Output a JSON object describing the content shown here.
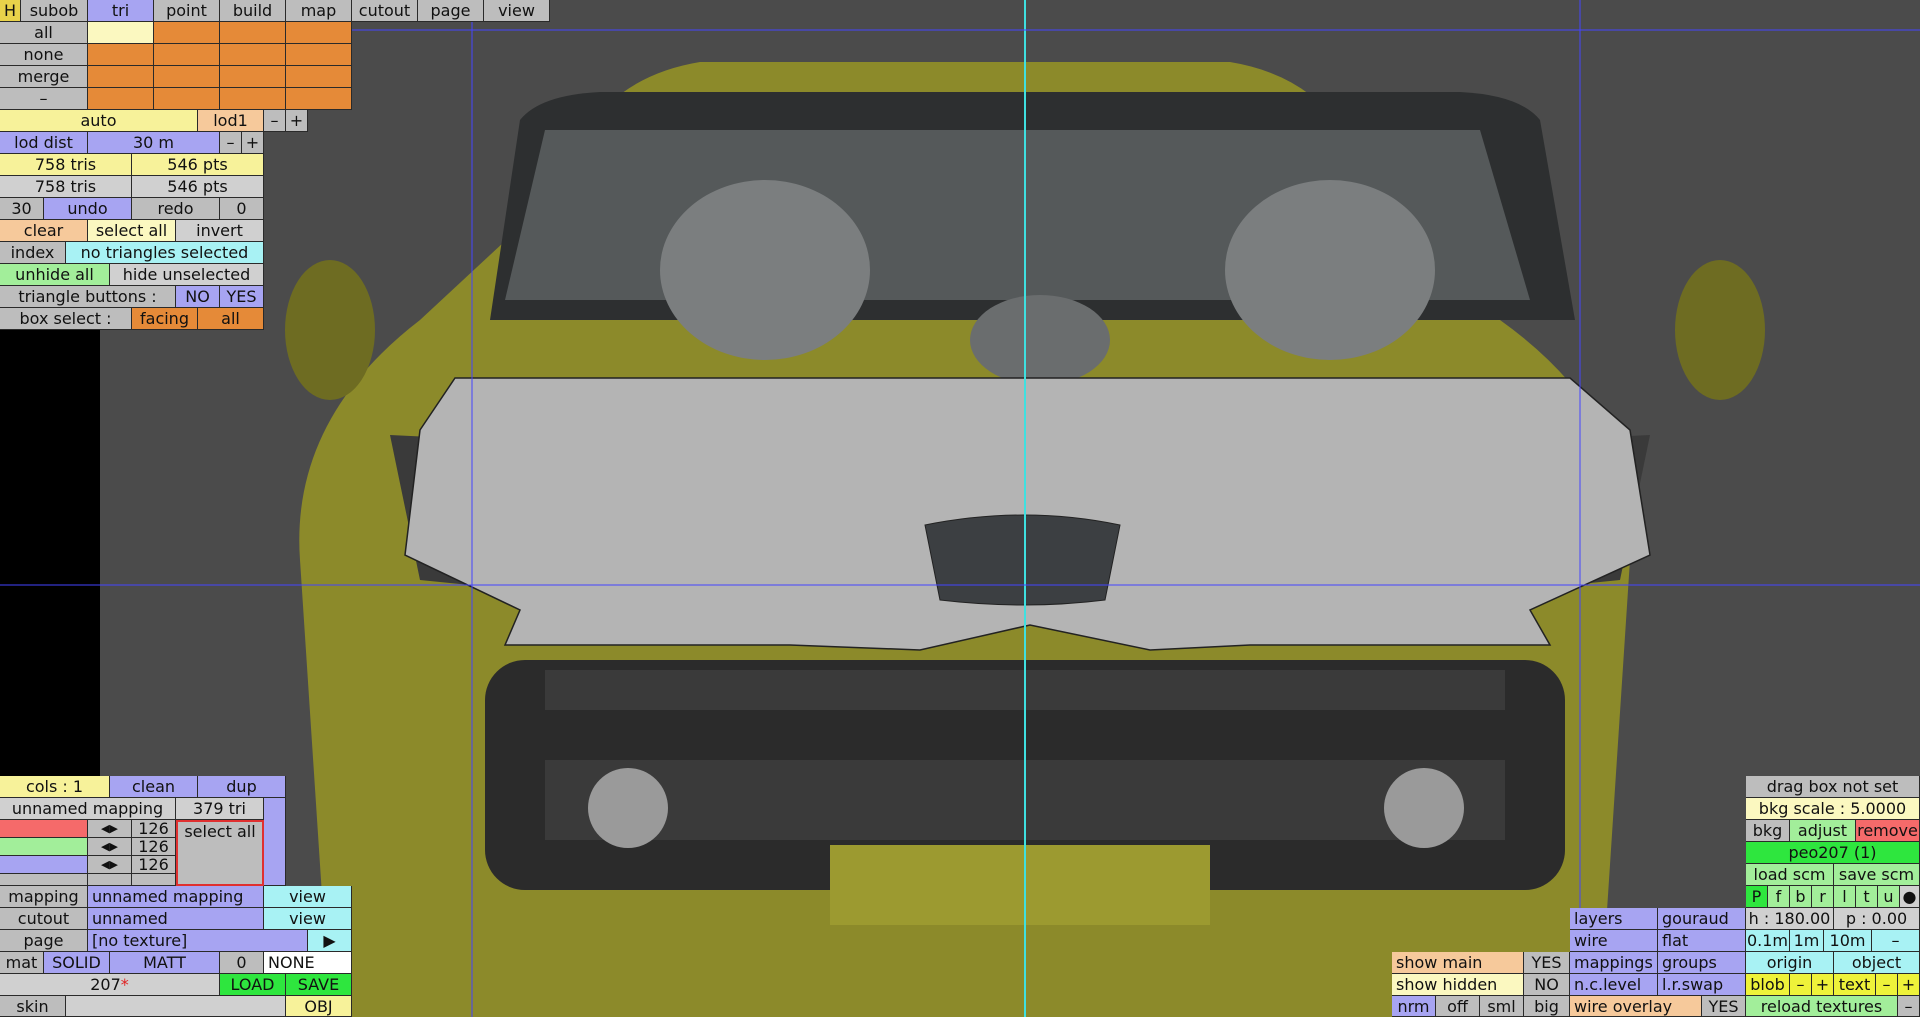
{
  "colors": {
    "car_body": "#8c8a2a",
    "bg": "#4b4b4b",
    "guide_cyan": "#3fe0e0",
    "guide_blue": "#4444ff"
  },
  "menu": {
    "h": "H",
    "tabs": [
      "subob",
      "tri",
      "point",
      "build",
      "map",
      "cutout",
      "page",
      "view"
    ],
    "active": "tri"
  },
  "select": {
    "all": "all",
    "none": "none",
    "merge": "merge",
    "dash": "–"
  },
  "lod": {
    "auto": "auto",
    "lod1": "lod1",
    "minus": "–",
    "plus": "+",
    "dist_label": "lod dist",
    "dist_val": "30 m"
  },
  "stats": {
    "tris1": "758 tris",
    "pts1": "546 pts",
    "tris2": "758 tris",
    "pts2": "546 pts"
  },
  "history": {
    "count": "30",
    "undo": "undo",
    "redo": "redo",
    "redo_count": "0"
  },
  "selection": {
    "clear": "clear",
    "select_all": "select all",
    "invert": "invert",
    "index": "index",
    "status": "no triangles selected",
    "unhide_all": "unhide all",
    "hide_unselected": "hide unselected"
  },
  "tri_buttons": {
    "label": "triangle buttons :",
    "no": "NO",
    "yes": "YES"
  },
  "box_select": {
    "label": "box select :",
    "facing": "facing",
    "all": "all"
  },
  "mapping_panel": {
    "cols": "cols : 1",
    "clean": "clean",
    "dup": "dup",
    "mapping_name": "unnamed mapping",
    "tri_count": "379 tri",
    "rgb": [
      "126",
      "126",
      "126"
    ],
    "select_all": "select all",
    "left": "◀",
    "right": "▶"
  },
  "props": {
    "mapping_label": "mapping",
    "mapping_val": "unnamed mapping",
    "view": "view",
    "cutout_label": "cutout",
    "cutout_val": "unnamed",
    "page_label": "page",
    "page_val": "[no texture]",
    "play": "▶",
    "mat": "mat",
    "solid": "SOLID",
    "matt": "MATT",
    "zero": "0",
    "none": "NONE",
    "obj_name": "207",
    "star": "*",
    "load": "LOAD",
    "save": "SAVE",
    "skin": "skin",
    "obj": "OBJ"
  },
  "bottom_right": {
    "show_main": "show main",
    "show_main_v": "YES",
    "show_hidden": "show hidden",
    "show_hidden_v": "NO",
    "nrm": "nrm",
    "off": "off",
    "sml": "sml",
    "big": "big",
    "layers": "layers",
    "gouraud": "gouraud",
    "wire": "wire",
    "flat": "flat",
    "mappings": "mappings",
    "groups": "groups",
    "nclevel": "n.c.level",
    "lrswap": "l.r.swap",
    "wire_overlay": "wire overlay",
    "wire_overlay_v": "YES"
  },
  "bkg_panel": {
    "drag": "drag box not set",
    "scale": "bkg scale : 5.0000",
    "bkg": "bkg",
    "adjust": "adjust",
    "remove": "remove",
    "name": "peo207 (1)",
    "load": "load scm",
    "save": "save scm",
    "views": [
      "P",
      "f",
      "b",
      "r",
      "l",
      "t",
      "u"
    ],
    "dot": "●",
    "h": "h : 180.00",
    "p": "p : 0.00",
    "d1": "0.1m",
    "d2": "1m",
    "d3": "10m",
    "minus": "–",
    "origin": "origin",
    "object": "object",
    "blob": "blob",
    "text": "text",
    "plus": "+",
    "reload": "reload textures"
  }
}
